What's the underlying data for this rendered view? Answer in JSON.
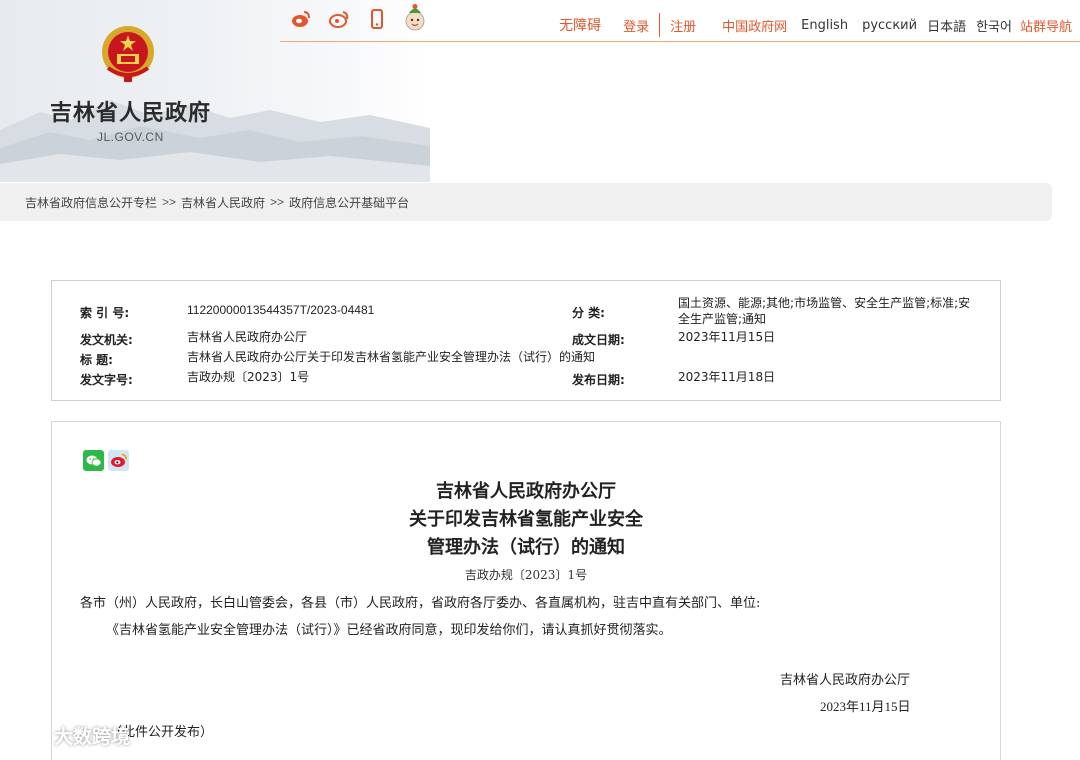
{
  "header": {
    "site_name": "吉林省人民政府",
    "site_domain": "JL.GOV.CN",
    "share_icons": [
      "weibo-icon",
      "weibo-icon",
      "mobile-icon",
      "mascot-icon"
    ],
    "links": {
      "accessibility": "无障碍",
      "login": "登录",
      "register": "注册",
      "gov_portal": "中国政府网",
      "english": "English",
      "russian": "русский",
      "japanese": "日本語",
      "korean": "한국어",
      "site_nav": "站群导航"
    },
    "accent_color": "#e4572e"
  },
  "breadcrumb": {
    "items": [
      "吉林省政府信息公开专栏",
      "吉林省人民政府",
      "政府信息公开基础平台"
    ],
    "separator": ">>"
  },
  "meta": {
    "index_label": "索 引 号:",
    "index_value": "11220000013544357T/2023-04481",
    "category_label": "分    类:",
    "category_value_line1": "国土资源、能源;其他;市场监管、安全生产监管;标准;安",
    "category_value_line2": "全生产监管;通知",
    "issuer_label": "发文机关:",
    "issuer_value": "吉林省人民政府办公厅",
    "created_label": "成文日期:",
    "created_value": "2023年11月15日",
    "title_label": "标      题:",
    "title_value": "吉林省人民政府办公厅关于印发吉林省氢能产业安全管理办法（试行）的通知",
    "docno_label": "发文字号:",
    "docno_value": "吉政办规〔2023〕1号",
    "published_label": "发布日期:",
    "published_value": "2023年11月18日"
  },
  "document": {
    "share_icons": [
      "wechat-icon",
      "weibo-icon"
    ],
    "title_line1": "吉林省人民政府办公厅",
    "title_line2": "关于印发吉林省氢能产业安全",
    "title_line3": "管理办法（试行）的通知",
    "doc_number": "吉政办规〔2023〕1号",
    "addressees": "各市（州）人民政府，长白山管委会，各县（市）人民政府，省政府各厅委办、各直属机构，驻吉中直有关部门、单位:",
    "body": "《吉林省氢能产业安全管理办法（试行）》已经省政府同意，现印发给你们，请认真抓好贯彻落实。",
    "signature": "吉林省人民政府办公厅",
    "date": "2023年11月15日",
    "note": "（此件公开发布）"
  },
  "watermark": {
    "text": "大数跨境"
  }
}
